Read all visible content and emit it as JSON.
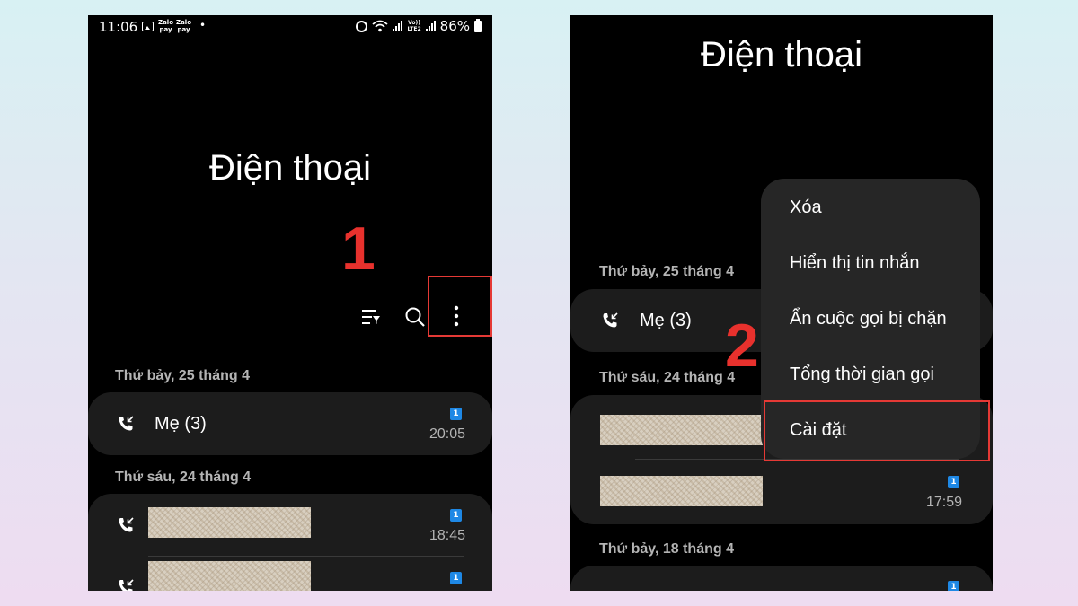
{
  "status_bar": {
    "time": "11:06",
    "zalo_pay_1": [
      "Zalo",
      "pay"
    ],
    "zalo_pay_2": [
      "Zalo",
      "pay"
    ],
    "dot": "•",
    "volte": [
      "Vo))",
      "LTE2"
    ],
    "battery": "86%"
  },
  "app": {
    "title": "Điện thoại"
  },
  "annotations": {
    "step1": "1",
    "step2": "2",
    "highlight_color": "#e53935"
  },
  "toolbar": {
    "icons": [
      "filter-icon",
      "search-icon",
      "more-options-icon"
    ]
  },
  "left_screen": {
    "sections": [
      {
        "header": "Thứ bảy, 25 tháng 4",
        "calls": [
          {
            "name": "Mẹ (3)",
            "sim": "1",
            "time": "20:05"
          }
        ]
      },
      {
        "header": "Thứ sáu, 24 tháng 4",
        "calls": [
          {
            "sim": "1",
            "time": "18:45"
          },
          {
            "sim": "1"
          }
        ]
      }
    ]
  },
  "right_screen": {
    "sections": [
      {
        "header": "Thứ bảy, 25 tháng 4",
        "calls": [
          {
            "name": "Mẹ (3)"
          }
        ]
      },
      {
        "header": "Thứ sáu, 24 tháng 4",
        "calls": [
          {},
          {
            "sim": "1",
            "time": "17:59"
          }
        ]
      },
      {
        "header": "Thứ bảy, 18 tháng 4",
        "calls": [
          {
            "sim": "1"
          }
        ]
      }
    ],
    "menu": {
      "items": [
        "Xóa",
        "Hiển thị tin nhắn",
        "Ẩn cuộc gọi bị chặn",
        "Tổng thời gian gọi",
        "Cài đặt"
      ]
    }
  },
  "colors": {
    "sim_badge": "#1e88e5",
    "step_number": "#e8312d",
    "card_bg": "#1c1c1c",
    "menu_bg": "#262626"
  }
}
